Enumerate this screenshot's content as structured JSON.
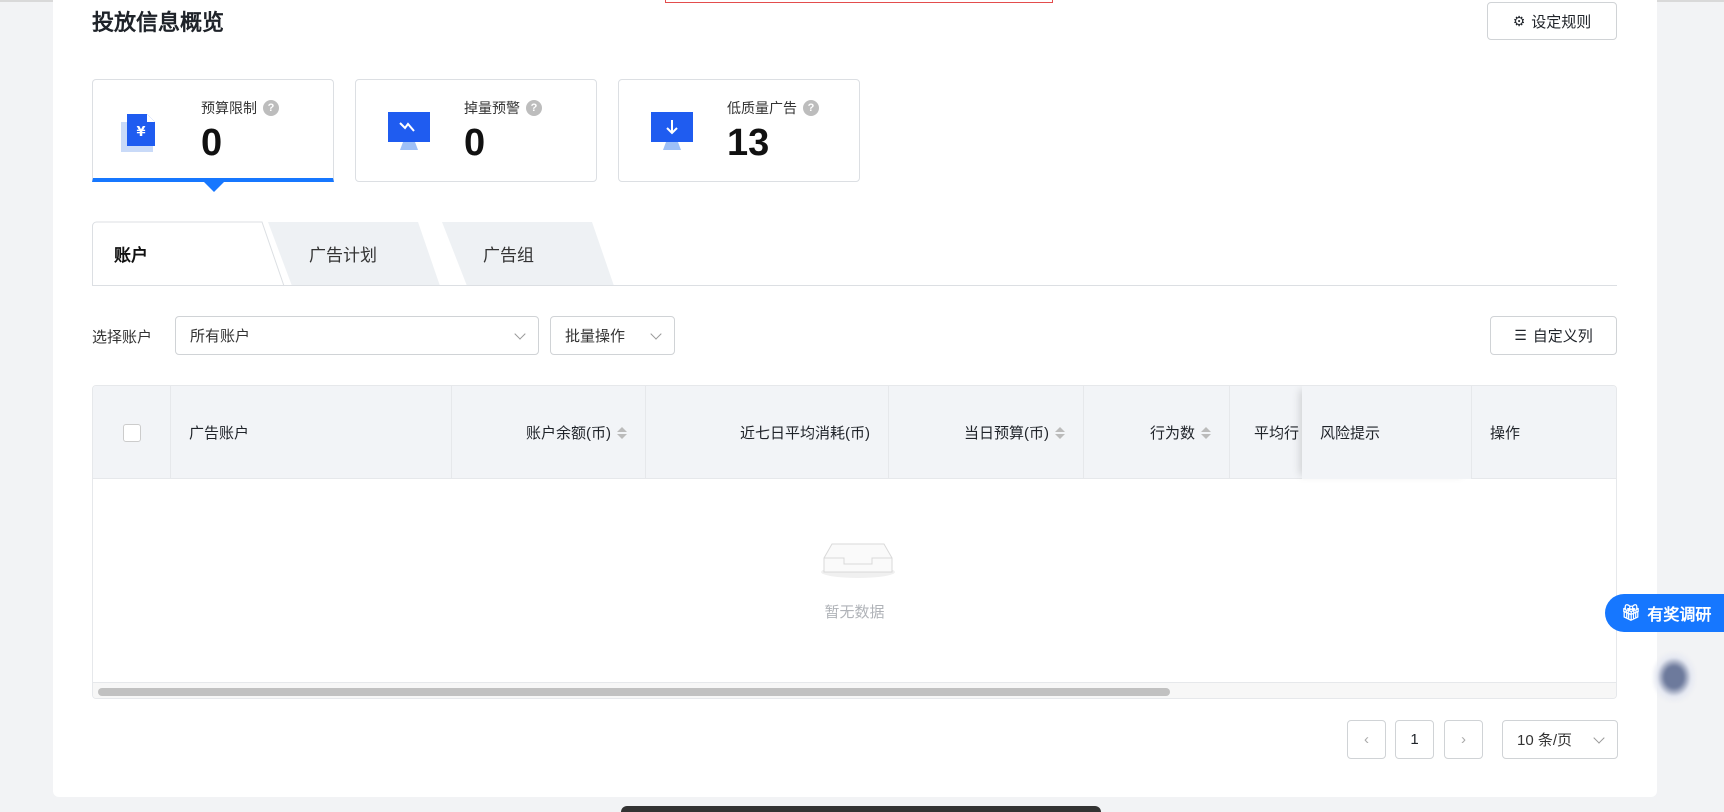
{
  "page": {
    "title": "投放信息概览",
    "rules_button": "设定规则"
  },
  "cards": [
    {
      "label": "预算限制",
      "value": "0",
      "help": "?"
    },
    {
      "label": "掉量预警",
      "value": "0",
      "help": "?"
    },
    {
      "label": "低质量广告",
      "value": "13",
      "help": "?"
    }
  ],
  "tabs": [
    "账户",
    "广告计划",
    "广告组"
  ],
  "filters": {
    "label": "选择账户",
    "account_select": "所有账户",
    "batch_select": "批量操作",
    "custom_columns": "自定义列"
  },
  "table": {
    "columns": [
      "广告账户",
      "账户余额(币)",
      "近七日平均消耗(币)",
      "当日预算(币)",
      "行为数",
      "平均行",
      "风险提示",
      "操作"
    ],
    "empty_text": "暂无数据"
  },
  "pagination": {
    "current": "1",
    "page_size": "10 条/页"
  },
  "survey": {
    "label": "有奖调研"
  },
  "colors": {
    "accent": "#1677ff"
  }
}
